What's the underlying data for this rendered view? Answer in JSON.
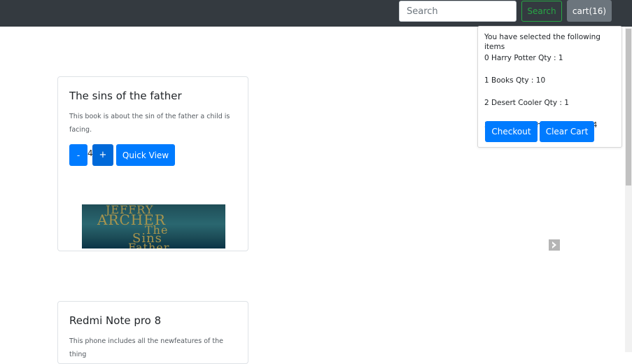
{
  "navbar": {
    "search_placeholder": "Search",
    "search_button": "Search",
    "cart_button": "cart(16)"
  },
  "cart_dropdown": {
    "header": "You have selected the following items",
    "items": [
      "0 Harry Potter Qty : 1",
      "1 Books Qty : 10",
      "2 Desert Cooler Qty : 1",
      "3 The sins of the father Qty : 4"
    ],
    "checkout_label": "Checkout",
    "clear_label": "Clear Cart"
  },
  "products": [
    {
      "title": "The sins of the father",
      "description": "This book is about the sin of the father a child is facing.",
      "minus_label": "-",
      "quantity": "4",
      "plus_label": "+",
      "quick_view_label": "Quick View"
    },
    {
      "title": "Redmi Note pro 8",
      "description": "This phone includes all the newfeatures of the thing"
    }
  ],
  "colors": {
    "navbar": "#343a40",
    "primary": "#007bff",
    "success": "#28a745",
    "secondary": "#6c757d"
  },
  "icons": {
    "carousel_next": "chevron-right-icon"
  }
}
